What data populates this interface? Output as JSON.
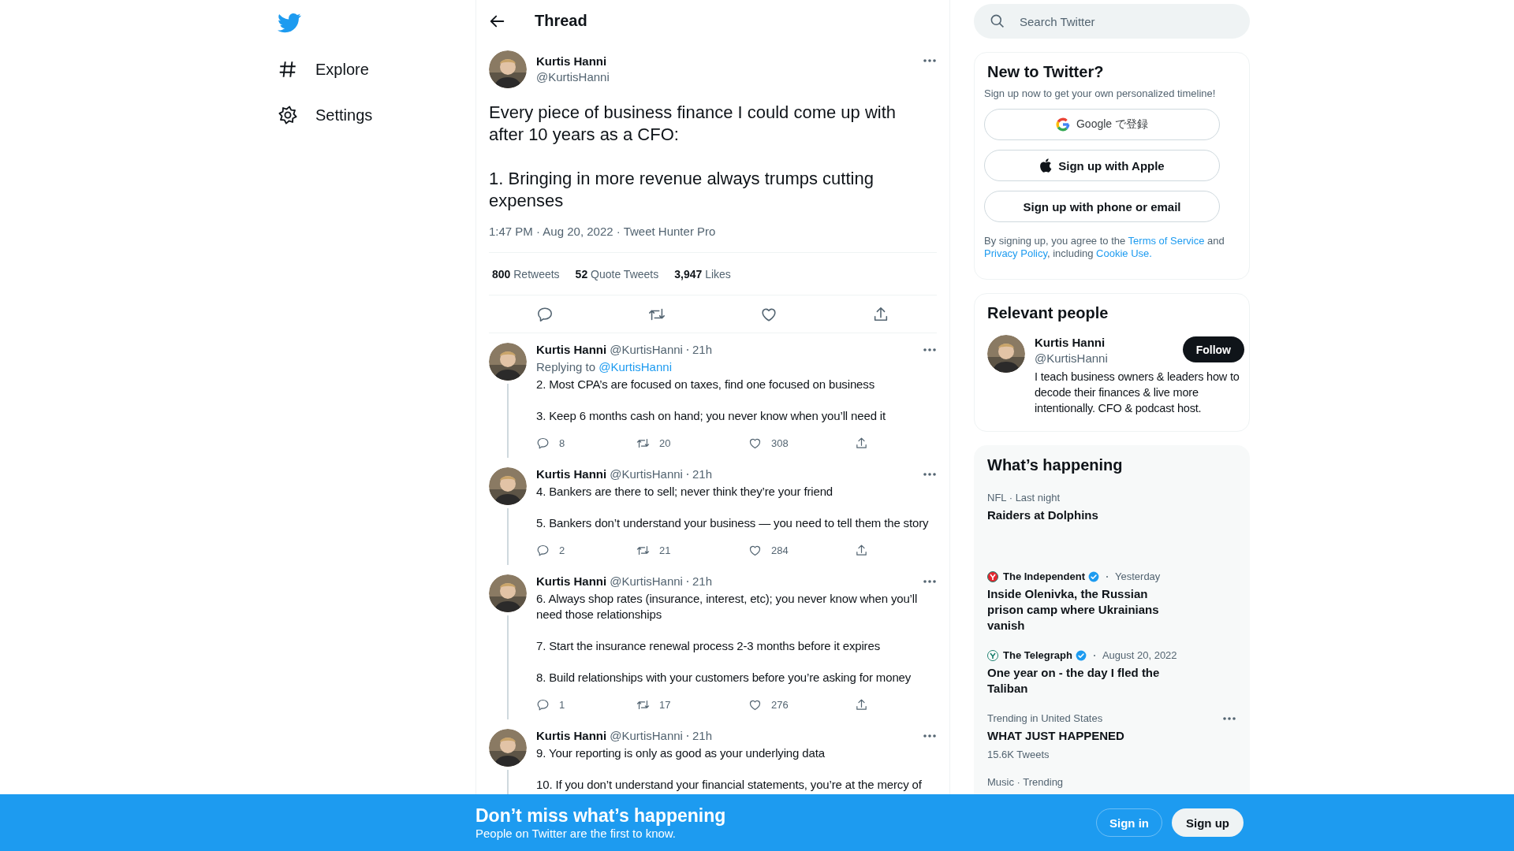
{
  "nav": {
    "items": [
      {
        "label": "Explore"
      },
      {
        "label": "Settings"
      }
    ]
  },
  "header": {
    "title": "Thread"
  },
  "main_tweet": {
    "name": "Kurtis Hanni",
    "handle": "@KurtisHanni",
    "paragraphs": [
      "Every piece of business finance I could come up with after 10 years as a CFO:",
      "1. Bringing in more revenue always trumps cutting expenses"
    ],
    "meta": "1:47 PM · Aug 20, 2022 · Tweet Hunter Pro",
    "stats": [
      {
        "count": "800",
        "label": "Retweets"
      },
      {
        "count": "52",
        "label": "Quote Tweets"
      },
      {
        "count": "3,947",
        "label": "Likes"
      }
    ]
  },
  "replies": [
    {
      "name": "Kurtis Hanni",
      "handle": "@KurtisHanni",
      "time": "21h",
      "replying_to": {
        "prefix": "Replying to",
        "handle": "@KurtisHanni"
      },
      "paragraphs": [
        "2. Most CPA’s are focused on taxes, find one focused on business",
        "3. Keep 6 months cash on hand; you never know when you’ll need it"
      ],
      "replies": "8",
      "retweets": "20",
      "likes": "308"
    },
    {
      "name": "Kurtis Hanni",
      "handle": "@KurtisHanni",
      "time": "21h",
      "paragraphs": [
        "4. Bankers are there to sell; never think they’re your friend",
        "5. Bankers don’t understand your business — you need to tell them the story"
      ],
      "replies": "2",
      "retweets": "21",
      "likes": "284"
    },
    {
      "name": "Kurtis Hanni",
      "handle": "@KurtisHanni",
      "time": "21h",
      "paragraphs": [
        "6. Always shop rates (insurance, interest, etc); you never know when you’ll need those relationships",
        "7. Start the insurance renewal process 2-3 months before it expires",
        "8. Build relationships with your customers before you’re asking for money"
      ],
      "replies": "1",
      "retweets": "17",
      "likes": "276"
    },
    {
      "name": "Kurtis Hanni",
      "handle": "@KurtisHanni",
      "time": "21h",
      "paragraphs": [
        "9. Your reporting is only as good as your underlying data",
        "10. If you don’t understand your financial statements, you’re at the mercy of"
      ]
    }
  ],
  "search": {
    "placeholder": "Search Twitter"
  },
  "signup_card": {
    "title": "New to Twitter?",
    "subtitle": "Sign up now to get your own personalized timeline!",
    "buttons": [
      {
        "label": "Google で登録",
        "kind": "google"
      },
      {
        "label": "Sign up with Apple",
        "kind": "apple"
      },
      {
        "label": "Sign up with phone or email",
        "kind": "plain"
      }
    ],
    "legal": [
      {
        "text": "By signing up, you agree to the ",
        "link": false
      },
      {
        "text": "Terms of Service",
        "link": true
      },
      {
        "text": " and ",
        "link": false
      },
      {
        "text": "Privacy Policy",
        "link": true
      },
      {
        "text": ", including ",
        "link": false
      },
      {
        "text": "Cookie Use.",
        "link": true
      }
    ]
  },
  "relevant_people": {
    "title": "Relevant people",
    "name": "Kurtis Hanni",
    "handle": "@KurtisHanni",
    "bio": "I teach business owners & leaders how to decode their finances & live more intentionally. CFO & podcast host.",
    "button": "Follow"
  },
  "trends": {
    "title": "What’s happening",
    "items": [
      {
        "kind": "trend",
        "context": "NFL · Last night",
        "title": "Raiders at Dolphins"
      },
      {
        "kind": "news",
        "source": "The Independent",
        "verified": true,
        "time": "Yesterday",
        "title": "Inside Olenivka, the Russian prison camp where Ukrainians vanish",
        "color": "#e5262f"
      },
      {
        "kind": "news",
        "source": "The Telegraph",
        "verified": true,
        "time": "August 20, 2022",
        "title": "One year on - the day I fled the Taliban",
        "color": "#ffffff"
      },
      {
        "kind": "trend",
        "context": "Trending in United States",
        "title": "WHAT JUST HAPPENED",
        "count": "15.6K Tweets",
        "more": true
      },
      {
        "kind": "trend",
        "context": "Music · Trending"
      }
    ]
  },
  "banner": {
    "title": "Don’t miss what’s happening",
    "subtitle": "People on Twitter are the first to know.",
    "buttons": [
      {
        "label": "Sign in",
        "kind": "outline"
      },
      {
        "label": "Sign up",
        "kind": "filled"
      }
    ]
  }
}
